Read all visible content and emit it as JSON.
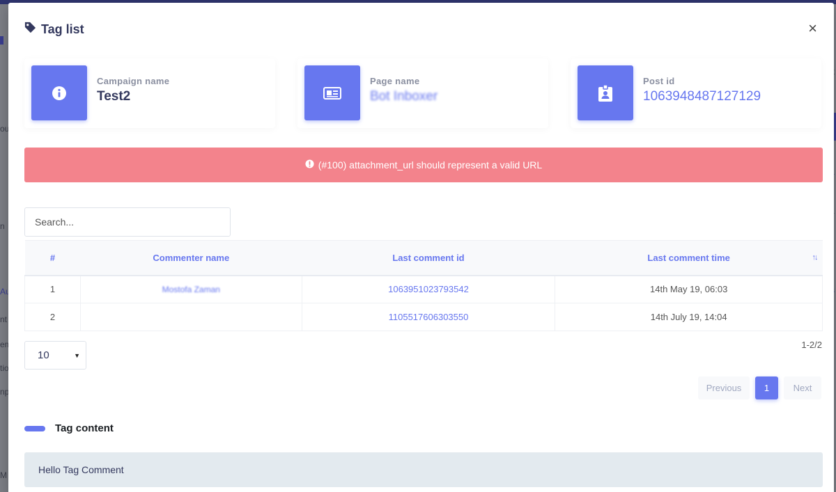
{
  "background": {
    "left_fragments": [
      "ou",
      "n",
      "Au",
      "nt",
      "em",
      "tio",
      "np",
      "M"
    ],
    "right_fragments": [
      "k",
      "L",
      "1",
      "s"
    ]
  },
  "modal": {
    "title": "Tag list",
    "title_icon": "tag-icon",
    "close_label": "×"
  },
  "cards": [
    {
      "label": "Campaign name",
      "value": "Test2",
      "icon": "info-circle-icon"
    },
    {
      "label": "Page name",
      "value": "Bot Inboxer",
      "icon": "newspaper-icon"
    },
    {
      "label": "Post id",
      "value": "1063948487127129",
      "icon": "id-badge-icon"
    }
  ],
  "alert": {
    "icon": "exclamation-circle-icon",
    "message": "(#100) attachment_url should represent a valid URL"
  },
  "search": {
    "placeholder": "Search..."
  },
  "table": {
    "columns": [
      "#",
      "Commenter name",
      "Last comment id",
      "Last comment time"
    ],
    "rows": [
      {
        "num": "1",
        "name": "Mostofa Zaman",
        "comment_id": "1063951023793542",
        "time": "14th May 19, 06:03"
      },
      {
        "num": "2",
        "name": "",
        "comment_id": "1105517606303550",
        "time": "14th July 19, 14:04"
      }
    ]
  },
  "length": {
    "value": "10"
  },
  "info": "1-2/2",
  "pagination": {
    "previous": "Previous",
    "current": "1",
    "next": "Next"
  },
  "section": {
    "title": "Tag content"
  },
  "tag_content": "Hello Tag Comment",
  "colors": {
    "primary": "#6777ef",
    "danger": "#f3838c",
    "content_bg": "#e3eaef"
  }
}
